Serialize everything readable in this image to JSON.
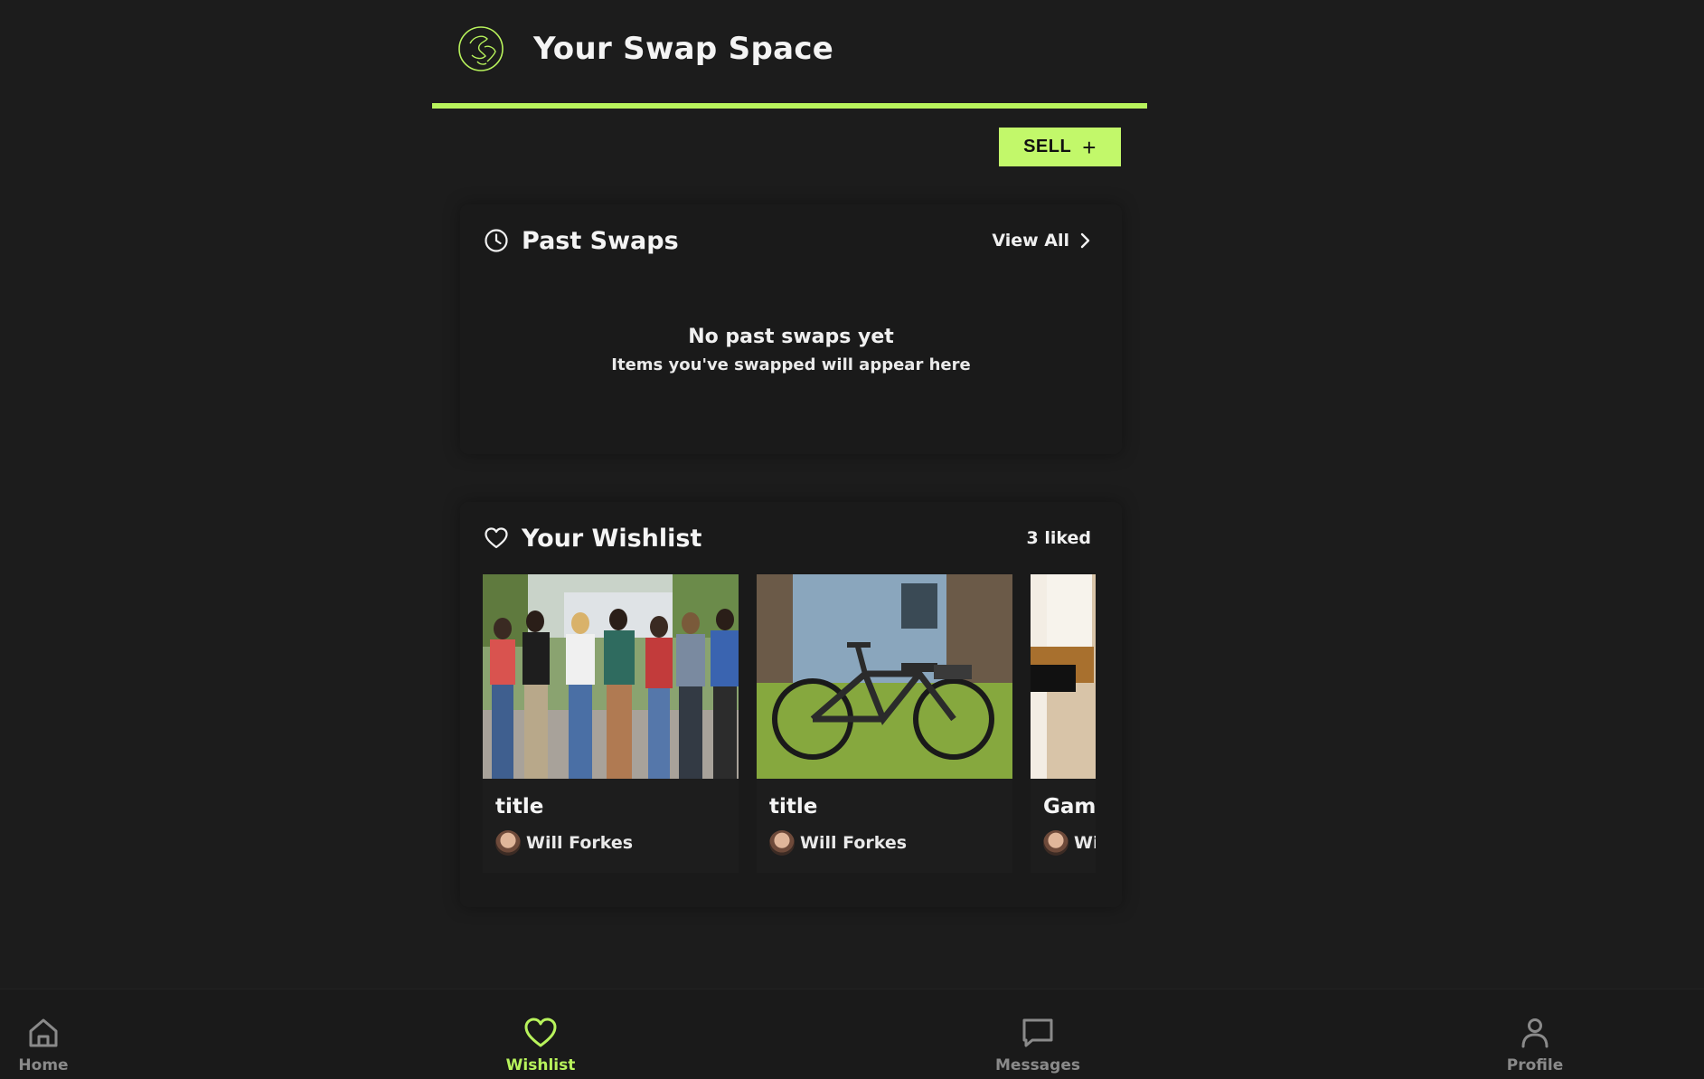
{
  "app": {
    "title": "Your Swap Space",
    "logo_icon": "globe-hand-logo",
    "accent_color": "#b8f35c"
  },
  "toolbar": {
    "sell_label": "SELL",
    "sell_icon": "plus-icon"
  },
  "past_swaps": {
    "title": "Past Swaps",
    "icon": "clock-icon",
    "view_all_label": "View All",
    "empty_title": "No past swaps yet",
    "empty_subtitle": "Items you've swapped will appear here"
  },
  "wishlist": {
    "title": "Your Wishlist",
    "icon": "heart-icon",
    "count_label": "3 liked",
    "items": [
      {
        "title": "title",
        "seller": "Will Forkes",
        "image": "group-of-students-photo"
      },
      {
        "title": "title",
        "seller": "Will Forkes",
        "image": "electric-bike-photo"
      },
      {
        "title": "Gam",
        "seller": "Wi",
        "image": "room-interior-photo"
      }
    ]
  },
  "bottom_nav": {
    "items": [
      {
        "label": "Home",
        "icon": "home-icon",
        "active": false
      },
      {
        "label": "Wishlist",
        "icon": "heart-icon",
        "active": true
      },
      {
        "label": "Messages",
        "icon": "chat-bubble-icon",
        "active": false
      },
      {
        "label": "Profile",
        "icon": "user-icon",
        "active": false
      }
    ]
  }
}
